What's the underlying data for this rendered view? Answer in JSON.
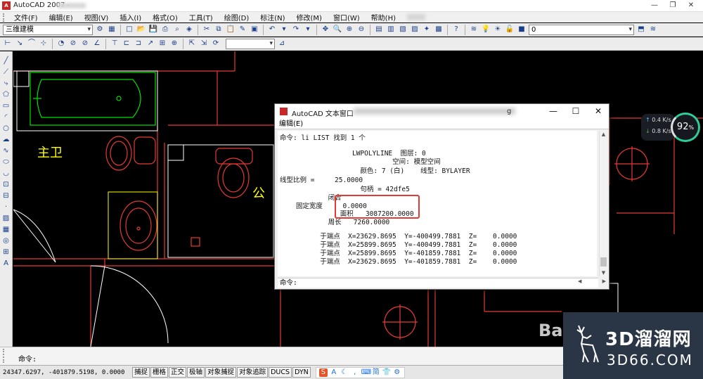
{
  "app": {
    "title": "AutoCAD 2007 -",
    "icon_label": "A"
  },
  "menu": {
    "items": [
      "文件(F)",
      "编辑(E)",
      "视图(V)",
      "插入(I)",
      "格式(O)",
      "工具(T)",
      "绘图(D)",
      "标注(N)",
      "修改(M)",
      "窗口(W)",
      "帮助(H)"
    ]
  },
  "toolbar": {
    "workspace": "三维建模",
    "layer": "0"
  },
  "drawing": {
    "labels": [
      "主卫",
      "公"
    ]
  },
  "text_window": {
    "title": "AutoCAD 文本窗口",
    "title_suffix": "g",
    "menu": "编辑(E)",
    "lines": [
      "命令: li LIST 找到 1 个",
      "",
      "                  LWPOLYLINE  图层: 0",
      "                            空间: 模型空间",
      "                    颜色: 7 (白)    线型: BYLAYER",
      "线型比例 =     25.0000",
      "                    句柄 = 42dfe5",
      "            闭合",
      "    固定宽度     0.0000",
      "               面积   3087200.0000",
      "            周长   7260.0000",
      "",
      "          于端点  X=23629.8695  Y=-400499.7881  Z=    0.0000",
      "          于端点  X=25899.8695  Y=-400499.7881  Z=    0.0000",
      "          于端点  X=25899.8695  Y=-401859.7881  Z=    0.0000",
      "          于端点  X=23629.8695  Y=-401859.7881  Z=    0.0000"
    ],
    "command_prompt": "命令:"
  },
  "net_widget": {
    "up": "0.4",
    "up_unit": "K/s",
    "down": "0.8",
    "down_unit": "K/s",
    "percent": "92",
    "percent_unit": "%"
  },
  "command_line": {
    "prompt": "命令:"
  },
  "status": {
    "coords": "24347.6297, -401879.5198, 0.0000",
    "buttons": [
      "捕捉",
      "栅格",
      "正交",
      "极轴",
      "对象捕捉",
      "对象追踪",
      "DUCS",
      "DYN"
    ],
    "tray_first": "S",
    "tray_ime": "简"
  },
  "watermark": {
    "brand_cn": "3D溜溜网",
    "brand_en": "3D66.COM",
    "baidu": "Ba"
  },
  "colors": {
    "model_background": "#000000",
    "walls": "#e53935",
    "fixtures_green": "#00e000",
    "room_label": "#ffff00",
    "highlight_box": "#e53935"
  }
}
